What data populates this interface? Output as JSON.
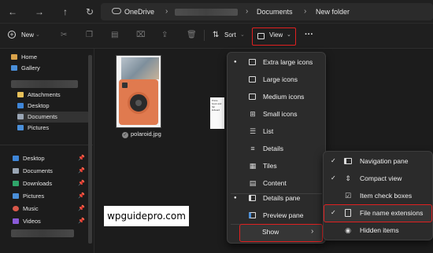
{
  "address_bar": {
    "crumbs": [
      "OneDrive",
      "Documents",
      "New folder"
    ]
  },
  "toolbar": {
    "new_label": "New",
    "sort_label": "Sort",
    "view_label": "View",
    "more_label": "···"
  },
  "sidebar": {
    "top_items": [
      {
        "label": "Home",
        "icon": "home-icon",
        "color": "#d9a24a"
      },
      {
        "label": "Gallery",
        "icon": "gallery-icon",
        "color": "#4a8fd9"
      }
    ],
    "folder_items": [
      {
        "label": "Attachments",
        "icon": "folder-icon",
        "color": "#e8c15a"
      },
      {
        "label": "Desktop",
        "icon": "desktop-icon",
        "color": "#3f86d8"
      },
      {
        "label": "Documents",
        "icon": "documents-icon",
        "color": "#9aa6b5"
      },
      {
        "label": "Pictures",
        "icon": "pictures-icon",
        "color": "#4a8fd9"
      }
    ],
    "pinned_items": [
      {
        "label": "Desktop",
        "icon": "desktop-icon",
        "color": "#3f86d8"
      },
      {
        "label": "Documents",
        "icon": "documents-icon",
        "color": "#9aa6b5"
      },
      {
        "label": "Downloads",
        "icon": "downloads-icon",
        "color": "#2fa56a"
      },
      {
        "label": "Pictures",
        "icon": "pictures-icon",
        "color": "#4a8fd9"
      },
      {
        "label": "Music",
        "icon": "music-icon",
        "color": "#d9584a"
      },
      {
        "label": "Videos",
        "icon": "videos-icon",
        "color": "#8a5ad9"
      }
    ]
  },
  "content": {
    "file_name": "polaroid.jpg",
    "doc_text": "Prints book and fan Edward"
  },
  "watermark": "wpguidepro.com",
  "view_menu": {
    "items": [
      {
        "label": "Extra large icons",
        "icon": "monitor-icon",
        "bullet": true
      },
      {
        "label": "Large icons",
        "icon": "monitor-icon",
        "bullet": false
      },
      {
        "label": "Medium icons",
        "icon": "monitor-icon",
        "bullet": false
      },
      {
        "label": "Small icons",
        "icon": "grid-icon",
        "bullet": false
      },
      {
        "label": "List",
        "icon": "list-icon",
        "bullet": false
      },
      {
        "label": "Details",
        "icon": "details-icon",
        "bullet": false
      },
      {
        "label": "Tiles",
        "icon": "tiles-icon",
        "bullet": false
      },
      {
        "label": "Content",
        "icon": "content-icon",
        "bullet": false
      }
    ],
    "pane_items": [
      {
        "label": "Details pane",
        "icon": "details-pane-icon",
        "bullet": true
      },
      {
        "label": "Preview pane",
        "icon": "preview-pane-icon",
        "bullet": false
      }
    ],
    "show_label": "Show"
  },
  "show_menu": {
    "items": [
      {
        "label": "Navigation pane",
        "icon": "nav-pane-icon",
        "checked": true
      },
      {
        "label": "Compact view",
        "icon": "compact-view-icon",
        "checked": true
      },
      {
        "label": "Item check boxes",
        "icon": "checkbox-icon",
        "checked": false
      },
      {
        "label": "File name extensions",
        "icon": "file-icon",
        "checked": true
      },
      {
        "label": "Hidden items",
        "icon": "eye-icon",
        "checked": false
      }
    ]
  },
  "colors": {
    "highlight_red": "#e02020",
    "camera_orange": "#e07a4f"
  }
}
